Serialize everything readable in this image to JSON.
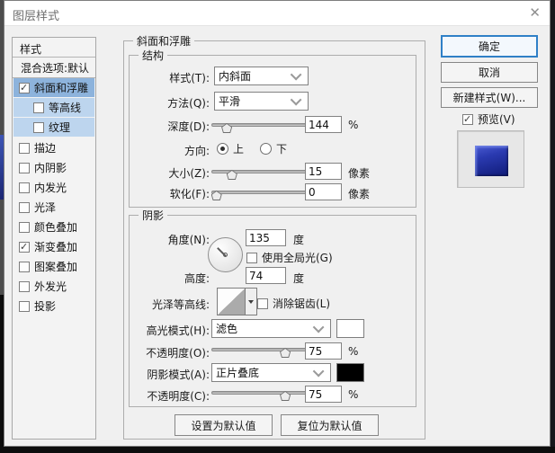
{
  "window": {
    "title": "图层样式",
    "close_glyph": "✕"
  },
  "sidebar": {
    "header": "样式",
    "items": [
      {
        "label": "混合选项:默认"
      },
      {
        "label": "斜面和浮雕"
      },
      {
        "label": "等高线"
      },
      {
        "label": "纹理"
      },
      {
        "label": "描边"
      },
      {
        "label": "内阴影"
      },
      {
        "label": "内发光"
      },
      {
        "label": "光泽"
      },
      {
        "label": "颜色叠加"
      },
      {
        "label": "渐变叠加"
      },
      {
        "label": "图案叠加"
      },
      {
        "label": "外发光"
      },
      {
        "label": "投影"
      }
    ]
  },
  "panel": {
    "title": "斜面和浮雕",
    "structure": {
      "title": "结构",
      "style_label": "样式(T):",
      "style_value": "内斜面",
      "technique_label": "方法(Q):",
      "technique_value": "平滑",
      "depth_label": "深度(D):",
      "depth_value": "144",
      "depth_unit": "%",
      "direction_label": "方向:",
      "direction_up": "上",
      "direction_down": "下",
      "size_label": "大小(Z):",
      "size_value": "15",
      "size_unit": "像素",
      "soften_label": "软化(F):",
      "soften_value": "0",
      "soften_unit": "像素"
    },
    "shading": {
      "title": "阴影",
      "angle_label": "角度(N):",
      "angle_value": "135",
      "angle_unit": "度",
      "global_light_label": "使用全局光(G)",
      "altitude_label": "高度:",
      "altitude_value": "74",
      "altitude_unit": "度",
      "gloss_contour_label": "光泽等高线:",
      "anti_alias_label": "消除锯齿(L)",
      "highlight_mode_label": "高光模式(H):",
      "highlight_mode_value": "滤色",
      "highlight_opacity_label": "不透明度(O):",
      "highlight_opacity_value": "75",
      "highlight_opacity_unit": "%",
      "shadow_mode_label": "阴影模式(A):",
      "shadow_mode_value": "正片叠底",
      "shadow_opacity_label": "不透明度(C):",
      "shadow_opacity_value": "75",
      "shadow_opacity_unit": "%"
    },
    "footer": {
      "set_default": "设置为默认值",
      "reset_default": "复位为默认值"
    }
  },
  "actions": {
    "ok": "确定",
    "cancel": "取消",
    "new_style": "新建样式(W)...",
    "preview": "预览(V)"
  },
  "colors": {
    "highlight_swatch": "#ffffff",
    "shadow_swatch": "#000000",
    "selected_item_bg": "#8db3dc",
    "sub_item_bg": "#bdd5ee",
    "focus_border": "#2f80c7"
  }
}
